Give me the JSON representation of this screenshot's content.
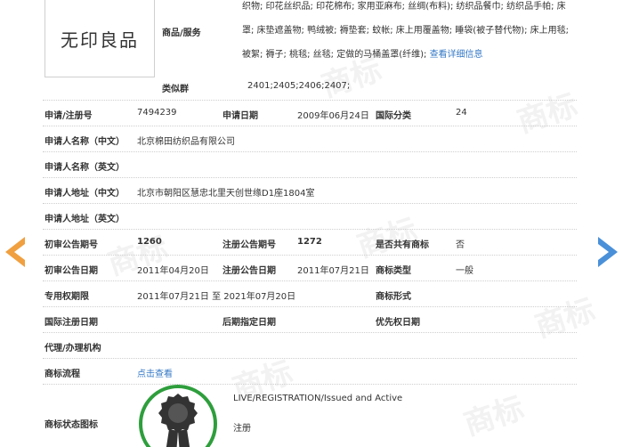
{
  "goods_services": {
    "label": "商品/服务",
    "text": "织物; 印花丝织品; 印花棉布; 家用亚麻布; 丝绸(布料); 纺织品餐巾; 纺织品手帕; 床罩; 床垫遮盖物; 鸭绒被; 褥垫套; 蚊帐; 床上用覆盖物; 睡袋(被子替代物); 床上用毯; 被絮; 褥子; 桃毯; 丝毯; 定做的马桶盖罩(纤维);",
    "link": "查看详细信息"
  },
  "logo": {
    "text": "无印良品"
  },
  "similar_group": {
    "label": "类似群",
    "value": "2401;2405;2406;2407;"
  },
  "fields": {
    "reg_no_label": "申请/注册号",
    "reg_no": "7494239",
    "app_date_label": "申请日期",
    "app_date": "2009年06月24日",
    "intl_class_label": "国际分类",
    "intl_class": "24",
    "applicant_cn_label": "申请人名称（中文）",
    "applicant_cn": "北京棉田纺织品有限公司",
    "applicant_en_label": "申请人名称（英文）",
    "address_cn_label": "申请人地址（中文）",
    "address_cn": "北京市朝阳区慧忠北里天创世缘D1座1804室",
    "address_en_label": "申请人地址（英文）",
    "prelim_no_label": "初审公告期号",
    "prelim_no": "1260",
    "reg_pub_no_label": "注册公告期号",
    "reg_pub_no": "1272",
    "shared_label": "是否共有商标",
    "shared": "否",
    "prelim_date_label": "初审公告日期",
    "prelim_date": "2011年04月20日",
    "reg_pub_date_label": "注册公告日期",
    "reg_pub_date": "2011年07月21日",
    "tm_type_label": "商标类型",
    "tm_type": "一般",
    "excl_period_label": "专用权期限",
    "excl_period": "2011年07月21日 至 2021年07月20日",
    "tm_form_label": "商标形式",
    "intl_reg_date_label": "国际注册日期",
    "later_date_label": "后期指定日期",
    "priority_date_label": "优先权日期",
    "agent_label": "代理/办理机构",
    "process_label": "商标流程",
    "process_link": "点击查看",
    "status_icon_label": "商标状态图标",
    "status_en": "LIVE/REGISTRATION/Issued and Active",
    "status_cn": "注册"
  },
  "watermark": {
    "text": "商标"
  },
  "colors": {
    "link": "#3478c6",
    "arrow_left": "#f0a040",
    "arrow_right": "#4a90d9",
    "badge_ring": "#2e9e3c"
  }
}
